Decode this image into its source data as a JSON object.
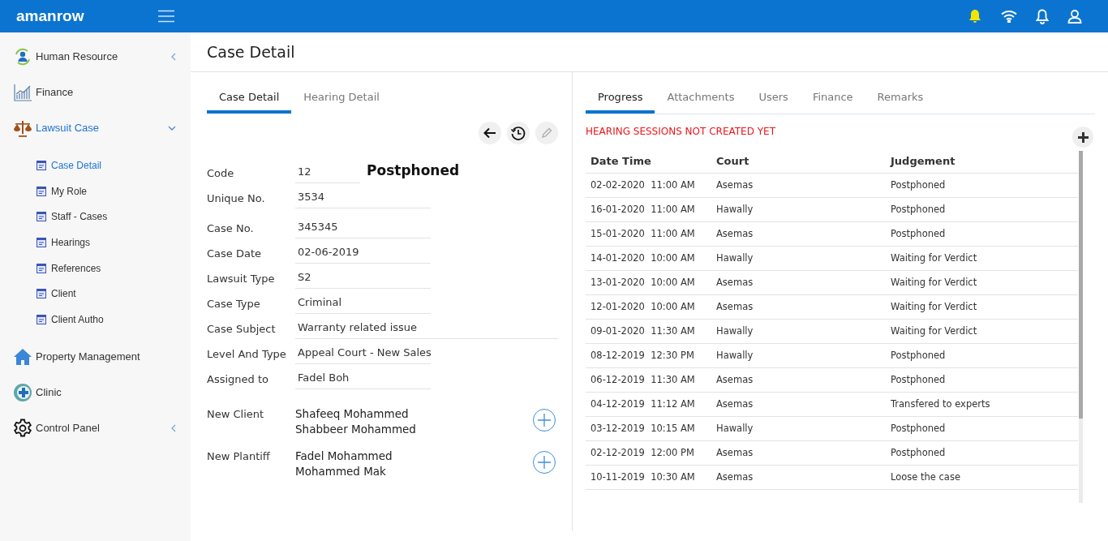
{
  "app": {
    "logo": "amanrow"
  },
  "sidebar": {
    "items": [
      {
        "label": "Human Resource",
        "kind": "group",
        "expanded": false,
        "selected": false
      },
      {
        "label": "Finance",
        "kind": "link",
        "selected": false
      },
      {
        "label": "Lawsuit Case",
        "kind": "group",
        "expanded": true,
        "selected": true,
        "children": [
          {
            "label": "Case Detail",
            "selected": true
          },
          {
            "label": "My Role",
            "selected": false
          },
          {
            "label": "Staff - Cases",
            "selected": false
          },
          {
            "label": "Hearings",
            "selected": false
          },
          {
            "label": "References",
            "selected": false
          },
          {
            "label": "Client",
            "selected": false
          },
          {
            "label": "Client Autho",
            "selected": false
          }
        ]
      },
      {
        "label": "Property Management",
        "kind": "link",
        "selected": false
      },
      {
        "label": "Clinic",
        "kind": "link",
        "selected": false
      },
      {
        "label": "Control Panel",
        "kind": "group",
        "expanded": false,
        "selected": false
      }
    ]
  },
  "page": {
    "title": "Case Detail"
  },
  "left_tabs": [
    {
      "label": "Case Detail",
      "selected": true
    },
    {
      "label": "Hearing Detail",
      "selected": false
    }
  ],
  "fields": [
    {
      "label": "Code",
      "value": "12",
      "kind": "code",
      "status": "Postphoned"
    },
    {
      "label": "Unique No.",
      "value": "3534",
      "kind": "text"
    },
    {
      "label": "Case No.",
      "value": "345345",
      "kind": "text"
    },
    {
      "label": "Case Date",
      "value": "02-06-2019",
      "kind": "text"
    },
    {
      "label": "Lawsuit Type",
      "value": "S2",
      "kind": "text"
    },
    {
      "label": "Case Type",
      "value": "Criminal",
      "kind": "text"
    },
    {
      "label": "Case Subject",
      "value": "Warranty related issue",
      "kind": "wide"
    },
    {
      "label": "Level And Type",
      "value": "Appeal Court - New Sales",
      "kind": "text"
    },
    {
      "label": "Assigned to",
      "value": "Fadel Boh",
      "kind": "text"
    }
  ],
  "parties": [
    {
      "label": "New Client",
      "names": [
        "Shafeeq Mohammed",
        "Shabbeer Mohammed"
      ]
    },
    {
      "label": "New Plantiff",
      "names": [
        "Fadel Mohammed",
        "Mohammed Mak"
      ]
    }
  ],
  "right_tabs": [
    {
      "label": "Progress",
      "selected": true
    },
    {
      "label": "Attachments",
      "selected": false
    },
    {
      "label": "Users",
      "selected": false
    },
    {
      "label": "Finance",
      "selected": false
    },
    {
      "label": "Remarks",
      "selected": false
    }
  ],
  "notice": "HEARING SESSIONS NOT CREATED YET",
  "table": {
    "columns": [
      "Date Time",
      "Court",
      "Judgement"
    ],
    "rows": [
      [
        "02-02-2020  11:00 AM",
        "Asemas",
        "Postphoned"
      ],
      [
        "16-01-2020  11:00 AM",
        "Hawally",
        "Postphoned"
      ],
      [
        "15-01-2020  11:00 AM",
        "Asemas",
        "Postphoned"
      ],
      [
        "14-01-2020  10:00 AM",
        "Hawally",
        "Waiting for Verdict"
      ],
      [
        "13-01-2020  10:00 AM",
        "Asemas",
        "Waiting for Verdict"
      ],
      [
        "12-01-2020  10:00 AM",
        "Asemas",
        "Waiting for Verdict"
      ],
      [
        "09-01-2020  11:30 AM",
        "Hawally",
        "Waiting for Verdict"
      ],
      [
        "08-12-2019  12:30 PM",
        "Hawally",
        "Postphoned"
      ],
      [
        "06-12-2019  11:30 AM",
        "Asemas",
        "Postphoned"
      ],
      [
        "04-12-2019  11:12 AM",
        "Asemas",
        "Transfered to experts"
      ],
      [
        "03-12-2019  10:15 AM",
        "Hawally",
        "Postphoned"
      ],
      [
        "02-12-2019  12:00 PM",
        "Asemas",
        "Postphoned"
      ],
      [
        "10-11-2019  10:30 AM",
        "Asemas",
        "Loose the case"
      ]
    ]
  }
}
